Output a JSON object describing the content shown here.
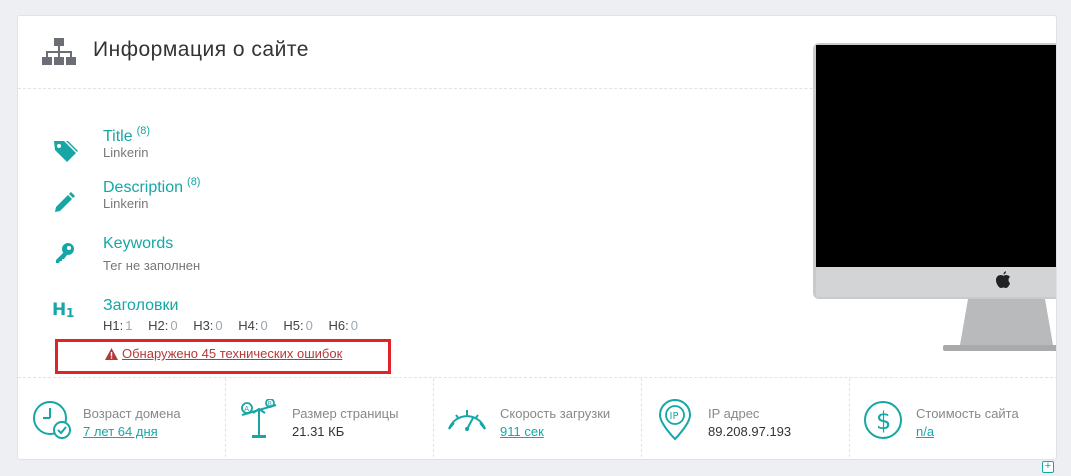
{
  "header": {
    "title": "Информация о сайте"
  },
  "info": {
    "title": {
      "label": "Title",
      "count": "(8)",
      "value": "Linkerin"
    },
    "description": {
      "label": "Description",
      "count": "(8)",
      "value": "Linkerin"
    },
    "keywords": {
      "label": "Keywords",
      "value": "Тег не заполнен"
    },
    "headings": {
      "label": "Заголовки",
      "items": [
        {
          "name": "H1:",
          "value": "1"
        },
        {
          "name": "H2:",
          "value": "0"
        },
        {
          "name": "H3:",
          "value": "0"
        },
        {
          "name": "H4:",
          "value": "0"
        },
        {
          "name": "H5:",
          "value": "0"
        },
        {
          "name": "H6:",
          "value": "0"
        }
      ]
    },
    "error_text": "Обнаружено 45 технических ошибок"
  },
  "stats": [
    {
      "label": "Возраст домена",
      "value": "7 лет 64 дня",
      "icon": "clock-check-icon"
    },
    {
      "label": "Размер страницы",
      "value": "21.31 КБ",
      "icon": "scales-icon"
    },
    {
      "label": "Скорость загрузки",
      "value": "911 сек",
      "icon": "speedometer-icon"
    },
    {
      "label": "IP адрес",
      "value": "89.208.97.193",
      "icon": "ip-pin-icon"
    },
    {
      "label": "Стоимость сайта",
      "value": "n/a",
      "icon": "dollar-circle-icon"
    }
  ],
  "colors": {
    "accent": "#16a6a6",
    "error": "#e02229",
    "error_text": "#b33a3a"
  },
  "corner": {
    "symbol": "+"
  }
}
